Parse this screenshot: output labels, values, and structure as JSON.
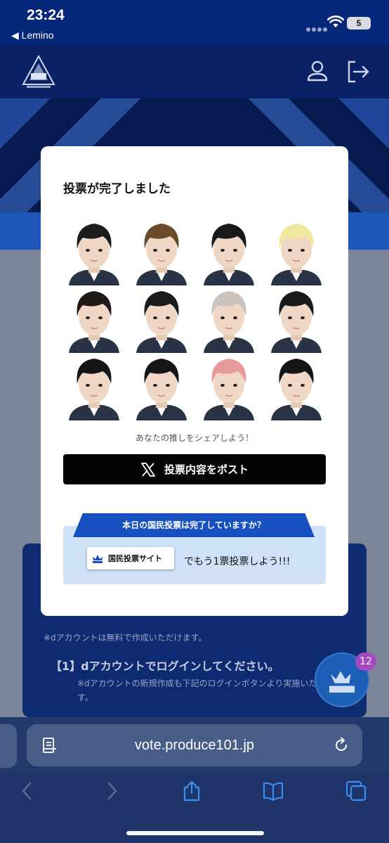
{
  "status": {
    "time": "23:24",
    "back_app": "◀ Lemino",
    "battery": "5"
  },
  "header": {
    "logo_icon": "produce101-logo-icon",
    "account_icon": "user-icon",
    "logout_icon": "logout-icon"
  },
  "modal": {
    "title": "投票が完了しました",
    "faces": [
      {
        "hair": "#1c1c1f"
      },
      {
        "hair": "#6b4a2b"
      },
      {
        "hair": "#18181b"
      },
      {
        "hair": "#f1e8a0"
      },
      {
        "hair": "#1f1a18"
      },
      {
        "hair": "#1b1b1e"
      },
      {
        "hair": "#c9c2bd"
      },
      {
        "hair": "#19191c"
      },
      {
        "hair": "#141416"
      },
      {
        "hair": "#161618"
      },
      {
        "hair": "#e79a9a"
      },
      {
        "hair": "#151517"
      }
    ],
    "share_caption": "あなたの推しをシェアしよう！",
    "post_button": "投票内容をポスト",
    "vote_question": "本日の国民投票は完了していますか？",
    "vote_site_button": "国民投票サイト",
    "vote_cta": "でもう1票投票しよう!!!"
  },
  "background": {
    "line1": "す。",
    "line1b": "※dアカウントは無料で作成いただけます。",
    "heading": "【1】dアカウントでログインしてください。",
    "note": "※dアカウントの新規作成も下記のログインボタンより実施いただけます。",
    "badge_count": "12"
  },
  "browser": {
    "url": "vote.produce101.jp"
  }
}
